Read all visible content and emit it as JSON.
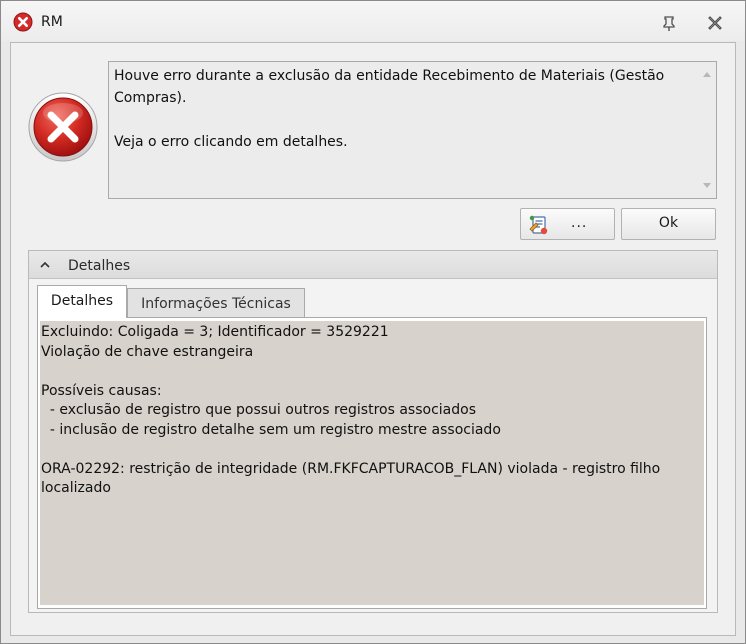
{
  "window": {
    "title": "RM",
    "title_icon": "error-circle-icon",
    "controls": [
      "pin-icon",
      "close-icon"
    ]
  },
  "message": {
    "icon": "error-x-icon",
    "text": "Houve erro durante a exclusão da entidade Recebimento de Materiais (Gestão\nCompras).\n\nVeja o erro clicando em detalhes."
  },
  "buttons": {
    "details_label": "...",
    "details_icon": "edit-report-icon",
    "ok_label": "Ok"
  },
  "details_group": {
    "title": "Detalhes",
    "tabs": [
      {
        "label": "Detalhes",
        "active": true
      },
      {
        "label": "Informações Técnicas",
        "active": false
      }
    ],
    "content": "Excluindo: Coligada = 3; Identificador = 3529221\nViolação de chave estrangeira\n\nPossíveis causas:\n  - exclusão de registro que possui outros registros associados\n  - inclusão de registro detalhe sem um registro mestre associado\n\nORA-02292: restrição de integridade (RM.FKFCAPTURACOB_FLAN) violada - registro filho\nlocalizado"
  },
  "colors": {
    "error_red": "#d8262a",
    "details_background": "#d7d2cb",
    "window_background": "#f0f0f0"
  }
}
